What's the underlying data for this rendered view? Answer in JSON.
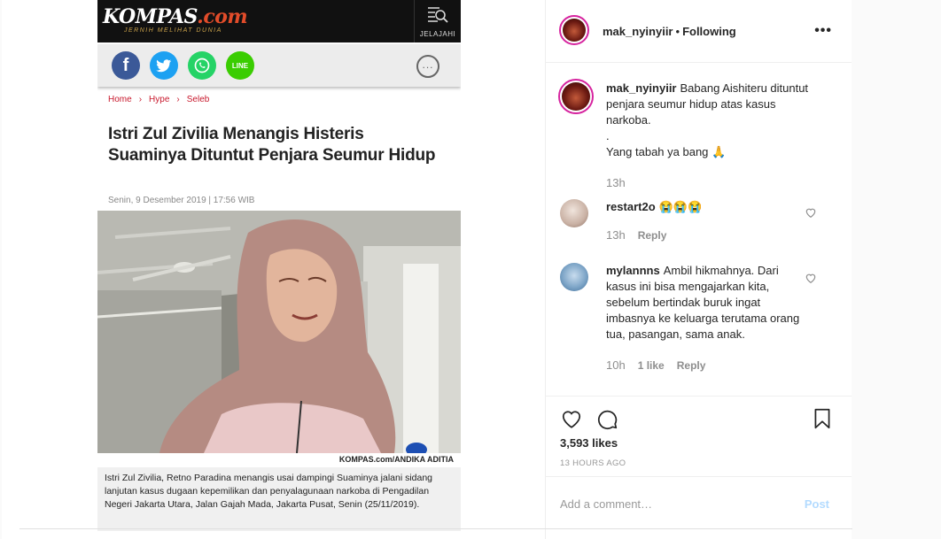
{
  "article": {
    "logo": "KOMPAS",
    "logo_domain": ".com",
    "tagline": "JERNIH MELIHAT DUNIA",
    "menu_label": "JELAJAHI",
    "share": {
      "facebook": "f",
      "twitter": "t",
      "whatsapp": "w",
      "line": "LINE",
      "comments": "..."
    },
    "breadcrumb": [
      "Home",
      "Hype",
      "Seleb"
    ],
    "breadcrumb_sep": "›",
    "title": "Istri Zul Zivilia Menangis Histeris Suaminya Dituntut Penjara Seumur Hidup",
    "date": "Senin, 9 Desember 2019 | 17:56 WIB",
    "photo_credit": "KOMPAS.com/ANDIKA ADITIA",
    "caption": "Istri Zul Zivilia, Retno Paradina menangis usai dampingi Suaminya jalani sidang lanjutan kasus dugaan kepemilikan dan penyalagunaan narkoba di Pengadilan Negeri Jakarta Utara, Jalan Gajah Mada, Jakarta Pusat, Senin (25/11/2019)."
  },
  "instagram": {
    "header": {
      "username": "mak_nyinyiir",
      "separator": "•",
      "follow_status": "Following",
      "more": "•••"
    },
    "comments": [
      {
        "username": "mak_nyinyiir",
        "text": "Babang Aishiteru dituntut penjara seumur hidup atas kasus narkoba.",
        "line2": ".",
        "line3": "Yang tabah ya bang 🙏",
        "time": "13h"
      },
      {
        "username": "restart2o",
        "text": "😭😭😭",
        "time": "13h",
        "reply": "Reply"
      },
      {
        "username": "mylannns",
        "text": "Ambil hikmahnya. Dari kasus ini bisa mengajarkan kita, sebelum bertindak buruk ingat imbasnya ke keluarga terutama orang tua, pasangan, sama anak.",
        "time": "10h",
        "likes": "1 like",
        "reply": "Reply"
      }
    ],
    "likes": "3,593 likes",
    "posted_ago": "13 HOURS AGO",
    "add_comment_placeholder": "Add a comment…",
    "post_label": "Post"
  },
  "colors": {
    "kompas_red": "#c8192d",
    "instagram_blue_disabled": "#b3dbff",
    "story_ring": "#d6249f"
  }
}
